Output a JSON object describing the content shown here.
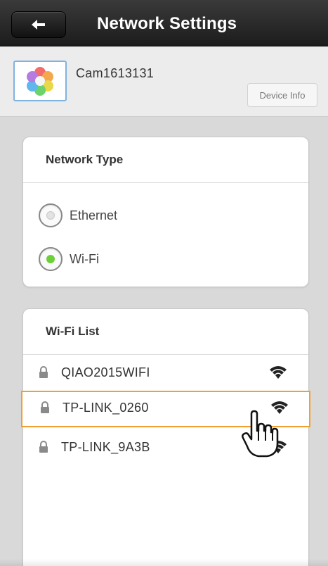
{
  "header": {
    "title": "Network Settings",
    "back_icon": "back-arrow-icon"
  },
  "device": {
    "name": "Cam1613131",
    "info_button": "Device Info",
    "thumbnail_icon": "flower-logo-icon"
  },
  "network_type": {
    "title": "Network Type",
    "options": [
      {
        "label": "Ethernet",
        "selected": false
      },
      {
        "label": "Wi-Fi",
        "selected": true
      }
    ]
  },
  "wifi_list": {
    "title": "Wi-Fi List",
    "items": [
      {
        "ssid": "QIAO2015WIFI",
        "locked": true,
        "selected": false
      },
      {
        "ssid": "TP-LINK_0260",
        "locked": true,
        "selected": true
      },
      {
        "ssid": "TP-LINK_9A3B",
        "locked": true,
        "selected": false
      }
    ]
  },
  "colors": {
    "header_bg": "#1c1c1c",
    "selection_border": "#f0a030",
    "radio_selected": "#6ccf3a",
    "thumb_border": "#7fb3e0"
  }
}
